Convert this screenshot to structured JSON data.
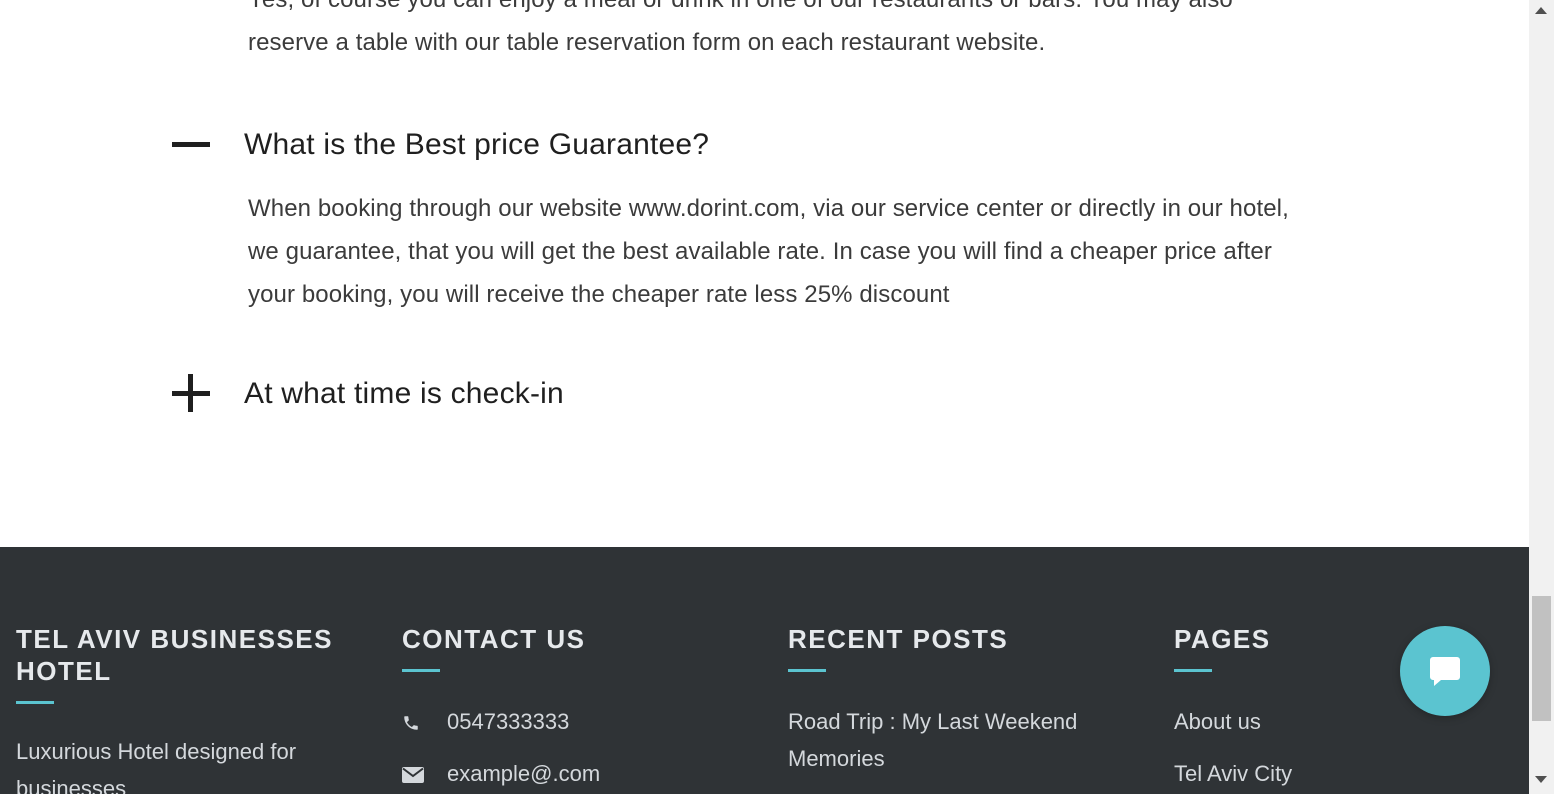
{
  "faq": {
    "previous_answer": "Yes, of course you can enjoy a meal or drink in one of our restaurants or bars. You may also reserve a table with our table reservation form on each restaurant website.",
    "items": [
      {
        "question": "What is the Best price Guarantee?",
        "answer": "When booking through our website www.dorint.com, via our service center or directly in our hotel, we guarantee, that you will get the best available rate. In case you will find a cheaper price after your booking, you will receive the cheaper rate less 25% discount",
        "expanded": true,
        "toggle_icon": "minus-icon"
      },
      {
        "question": "At what time is check-in",
        "expanded": false,
        "toggle_icon": "plus-icon"
      }
    ]
  },
  "footer": {
    "about": {
      "heading": "TEL AVIV BUSINESSES HOTEL",
      "text": "Luxurious Hotel designed for businesses"
    },
    "contact": {
      "heading": "CONTACT US",
      "phone": "0547333333",
      "email": "example@.com",
      "phone_icon": "phone-icon",
      "email_icon": "envelope-icon"
    },
    "recent_posts": {
      "heading": "RECENT POSTS",
      "posts": [
        "Road Trip : My Last Weekend Memories"
      ]
    },
    "pages": {
      "heading": "PAGES",
      "links": [
        "About us",
        "Tel Aviv City"
      ]
    }
  },
  "chat": {
    "icon": "chat-bubble-icon"
  },
  "colors": {
    "accent": "#5bc4d0",
    "footer_bg": "#2f3336",
    "heading_text": "#1f1f1f",
    "body_text": "#3b3b3b"
  }
}
